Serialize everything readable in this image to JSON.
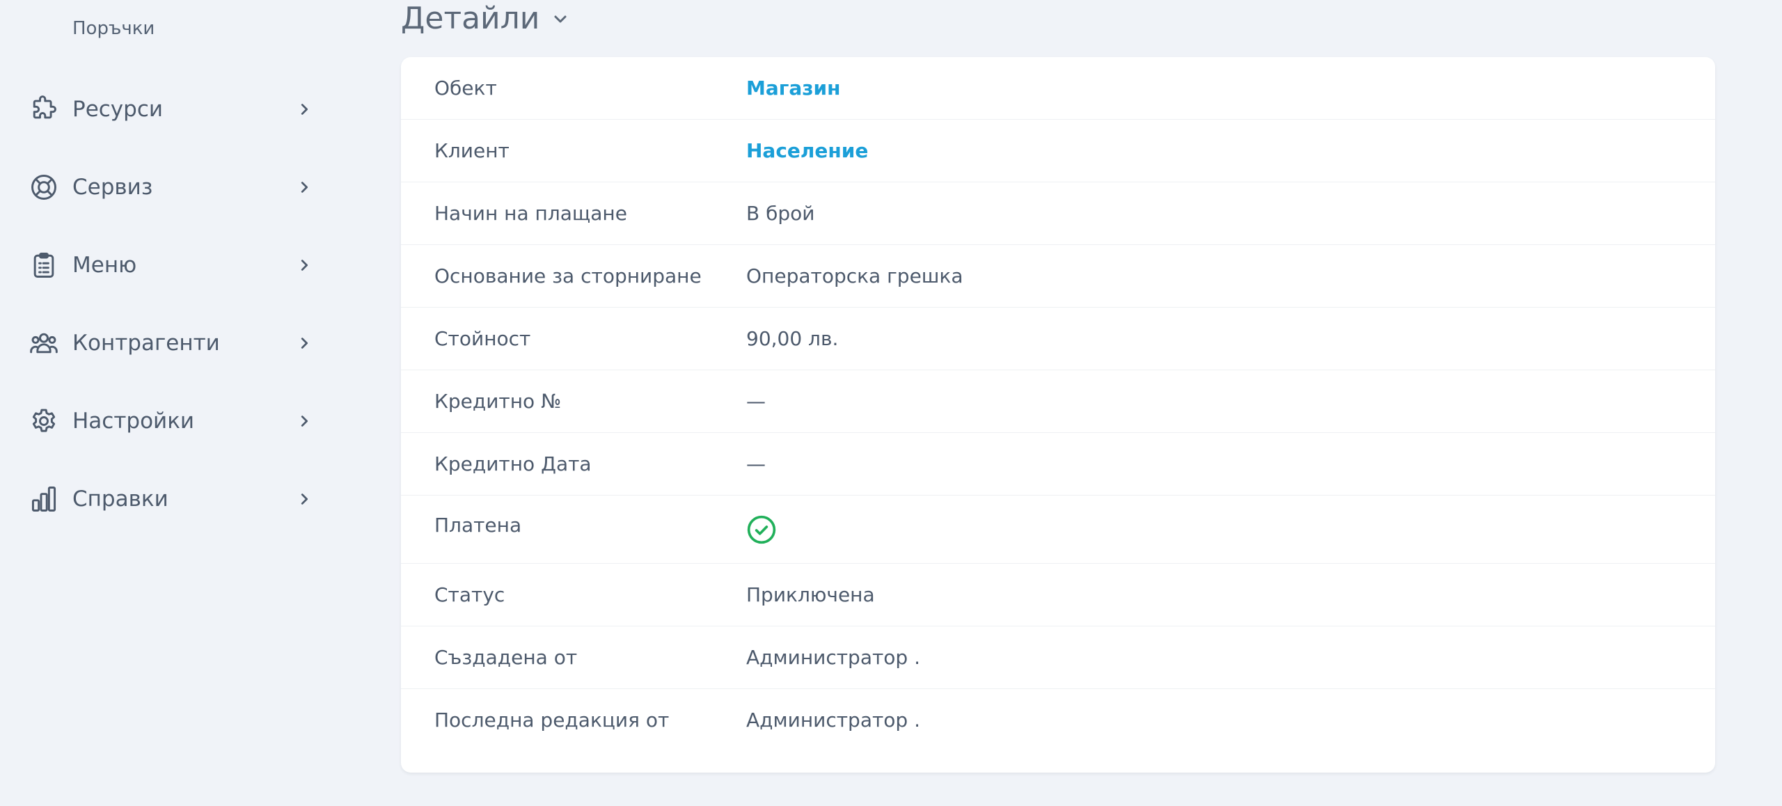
{
  "sidebar": {
    "sub_item": "Поръчки",
    "items": [
      {
        "label": "Ресурси",
        "icon": "puzzle-icon"
      },
      {
        "label": "Сервиз",
        "icon": "lifebuoy-icon"
      },
      {
        "label": "Меню",
        "icon": "clipboard-list-icon"
      },
      {
        "label": "Контрагенти",
        "icon": "users-group-icon"
      },
      {
        "label": "Настройки",
        "icon": "gear-icon"
      },
      {
        "label": "Справки",
        "icon": "bar-chart-icon"
      }
    ]
  },
  "details": {
    "title": "Детайли",
    "rows": [
      {
        "label": "Обект",
        "value": "Магазин"
      },
      {
        "label": "Клиент",
        "value": "Население"
      },
      {
        "label": "Начин на плащане",
        "value": "В брой"
      },
      {
        "label": "Основание за сторниране",
        "value": "Операторска грешка"
      },
      {
        "label": "Стойност",
        "value": "90,00 лв."
      },
      {
        "label": "Кредитно №",
        "value": "—"
      },
      {
        "label": "Кредитно Дата",
        "value": "—"
      },
      {
        "label": "Платена",
        "icon": "check-circle-icon"
      },
      {
        "label": "Статус",
        "value": "Приключена"
      },
      {
        "label": "Създадена от",
        "value": "Администратор ."
      },
      {
        "label": "Последна редакция от",
        "value": "Администратор ."
      }
    ]
  },
  "colors": {
    "background": "#f0f3f8",
    "text": "#4d5a6c",
    "link": "#1b9fd8",
    "success": "#21b05a"
  }
}
